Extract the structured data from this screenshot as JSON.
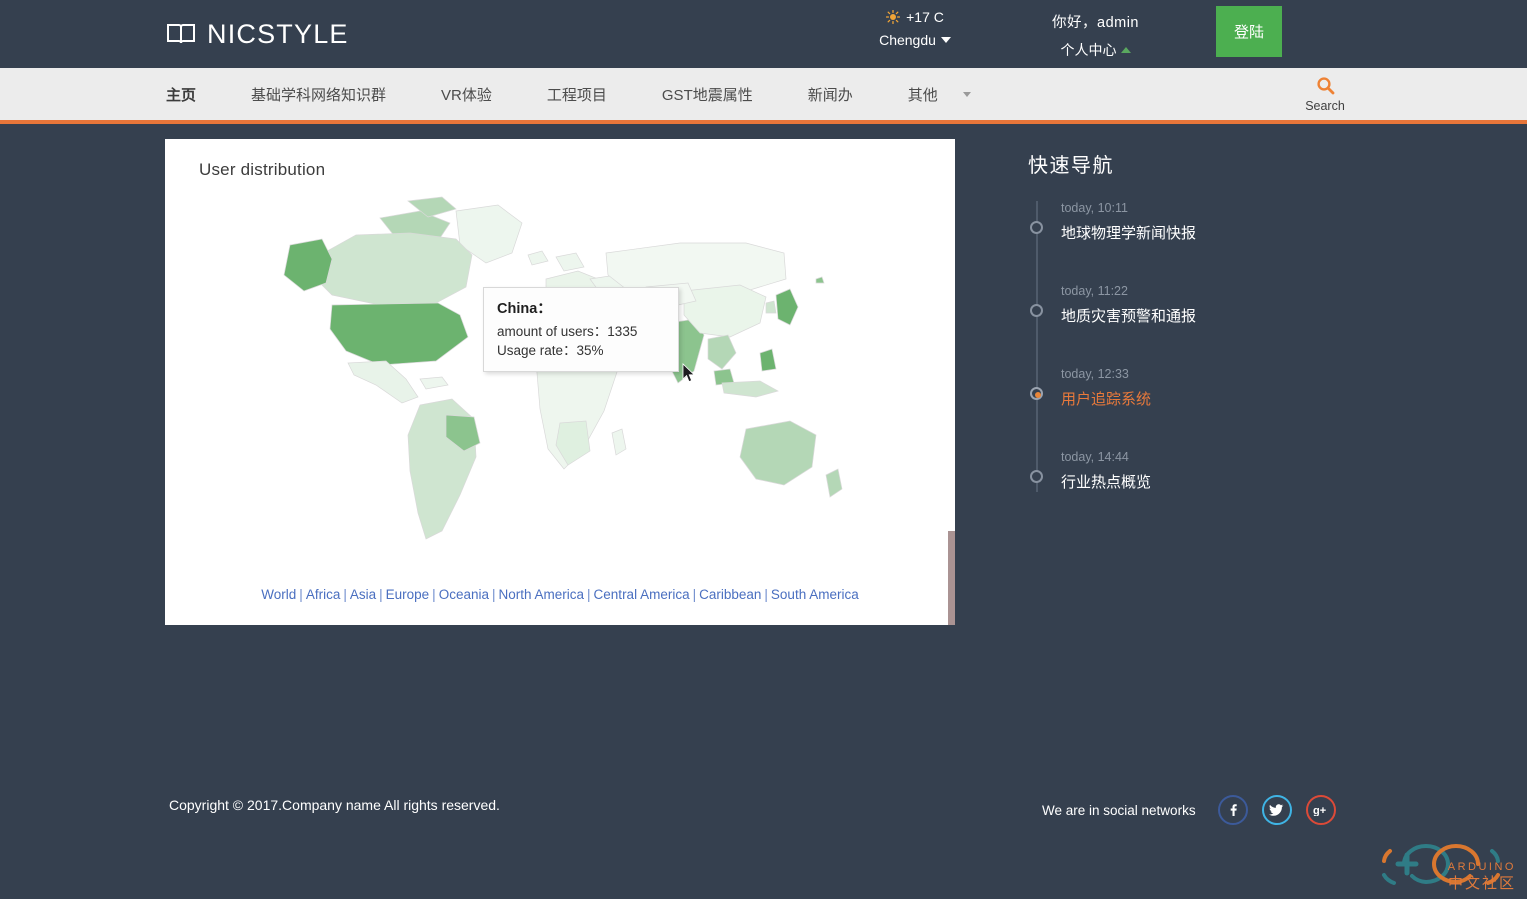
{
  "header": {
    "logo_text": "NICSTYLE",
    "logo_icon": "open-book-icon",
    "weather": {
      "icon": "sun-icon",
      "temperature": "+17 C",
      "city": "Chengdu",
      "chevron": "chevron-down-icon"
    },
    "account": {
      "greeting": "你好，admin",
      "center_label": "个人中心",
      "chevron": "chevron-up-icon"
    },
    "login_button": "登陆"
  },
  "nav": {
    "items": [
      {
        "label": "主页",
        "active": true
      },
      {
        "label": "基础学科网络知识群",
        "active": false
      },
      {
        "label": "VR体验",
        "active": false
      },
      {
        "label": "工程项目",
        "active": false
      },
      {
        "label": "GST地震属性",
        "active": false
      },
      {
        "label": "新闻办",
        "active": false
      },
      {
        "label": "其他",
        "active": false,
        "has_caret": true
      }
    ],
    "search": {
      "icon": "search-icon",
      "label": "Search"
    }
  },
  "card": {
    "title": "User distribution",
    "tooltip": {
      "country": "China：",
      "users_line": "amount of users：1335",
      "usage_line": "Usage rate：35%",
      "users_value": 1335,
      "usage_rate": "35%"
    },
    "region_links": [
      "World",
      "Africa",
      "Asia",
      "Europe",
      "Oceania",
      "North America",
      "Central America",
      "Caribbean",
      "South America"
    ],
    "separator": "|"
  },
  "quicknav": {
    "title": "快速导航",
    "items": [
      {
        "time": "today, 10:11",
        "text": "地球物理学新闻快报",
        "active": false
      },
      {
        "time": "today, 11:22",
        "text": "地质灾害预警和通报",
        "active": false
      },
      {
        "time": "today, 12:33",
        "text": "用户追踪系统",
        "active": true
      },
      {
        "time": "today, 14:44",
        "text": "行业热点概览",
        "active": false
      }
    ]
  },
  "footer": {
    "copyright": "Copyright © 2017.Company name All rights reserved.",
    "social_label": "We are in social networks",
    "social": [
      {
        "name": "facebook-icon",
        "glyph": "f"
      },
      {
        "name": "twitter-icon",
        "glyph": "🐦"
      },
      {
        "name": "google-plus-icon",
        "glyph": "g+"
      }
    ]
  },
  "watermark": {
    "brand": "ARDUINO",
    "community": "中文社区"
  },
  "colors": {
    "page_bg": "#35404f",
    "nav_bg": "#ececec",
    "accent_orange": "#e8763a",
    "login_green": "#4caf50",
    "link_blue": "#4a6fc0",
    "map_green": "#6cb36f"
  }
}
